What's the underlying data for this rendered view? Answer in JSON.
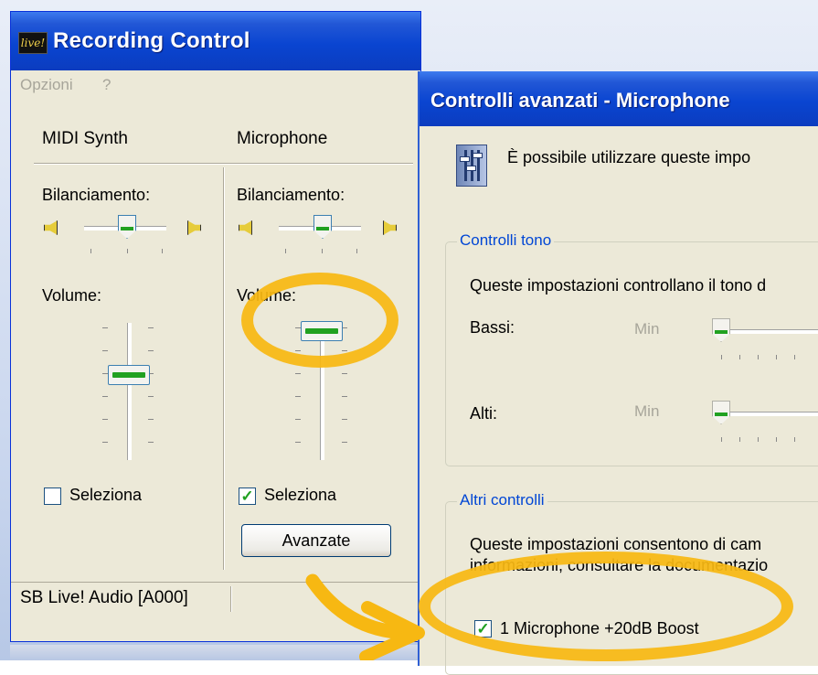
{
  "recording_window": {
    "title": "Recording Control",
    "logo_text": "live!",
    "menu": [
      "Opzioni",
      "?"
    ],
    "channels": [
      {
        "name": "MIDI Synth",
        "balance_label": "Bilanciamento:",
        "volume_label": "Volume:",
        "select_label": "Seleziona",
        "selected": false
      },
      {
        "name": "Microphone",
        "balance_label": "Bilanciamento:",
        "volume_label": "Volume:",
        "select_label": "Seleziona",
        "selected": true,
        "advanced_button": "Avanzate"
      }
    ],
    "status": "SB Live! Audio [A000]",
    "check_mark": "✓"
  },
  "advanced_dialog": {
    "title": "Controlli avanzati - Microphone",
    "intro": "È possibile utilizzare queste impo",
    "tone_group": {
      "title": "Controlli tono",
      "description": "Queste impostazioni controllano il tono d",
      "bass_label": "Bassi:",
      "treble_label": "Alti:",
      "min_label": "Min"
    },
    "other_group": {
      "title": "Altri controlli",
      "description_line1": "Queste impostazioni consentono di cam",
      "description_line2": "informazioni, consultare la documentazio",
      "boost_label": "1  Microphone +20dB Boost",
      "boost_checked": true
    }
  },
  "annotation_color": "#f7b812"
}
